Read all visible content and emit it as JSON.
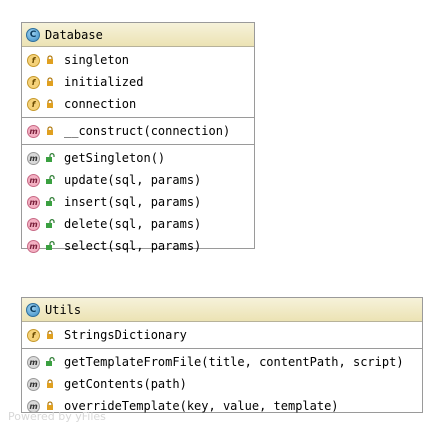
{
  "classes": [
    {
      "name": "Database",
      "icon": "class-icon",
      "fields": [
        {
          "name": "singleton",
          "kind": "static-field",
          "visibility": "private"
        },
        {
          "name": "initialized",
          "kind": "static-field",
          "visibility": "private"
        },
        {
          "name": "connection",
          "kind": "static-field",
          "visibility": "private"
        }
      ],
      "constructors": [
        {
          "name": "__construct(connection)",
          "kind": "method",
          "visibility": "private"
        }
      ],
      "methods": [
        {
          "name": "getSingleton()",
          "kind": "static-method",
          "visibility": "public"
        },
        {
          "name": "update(sql, params)",
          "kind": "method",
          "visibility": "public"
        },
        {
          "name": "insert(sql, params)",
          "kind": "method",
          "visibility": "public"
        },
        {
          "name": "delete(sql, params)",
          "kind": "method",
          "visibility": "public"
        },
        {
          "name": "select(sql, params)",
          "kind": "method",
          "visibility": "public"
        }
      ]
    },
    {
      "name": "Utils",
      "icon": "class-icon",
      "fields": [
        {
          "name": "StringsDictionary",
          "kind": "static-field",
          "visibility": "private"
        }
      ],
      "methods": [
        {
          "name": "getTemplateFromFile(title, contentPath, script)",
          "kind": "static-method",
          "visibility": "public"
        },
        {
          "name": "getContents(path)",
          "kind": "static-method",
          "visibility": "private"
        },
        {
          "name": "overrideTemplate(key, value, template)",
          "kind": "static-method",
          "visibility": "private"
        }
      ]
    }
  ],
  "watermark": "Powered by yFiles",
  "colors": {
    "header_top": "#f6f2da",
    "header_bottom": "#ece3b4",
    "border": "#9a9a9a",
    "private_lock": "#e0a020",
    "public_open": "#3aa040"
  }
}
